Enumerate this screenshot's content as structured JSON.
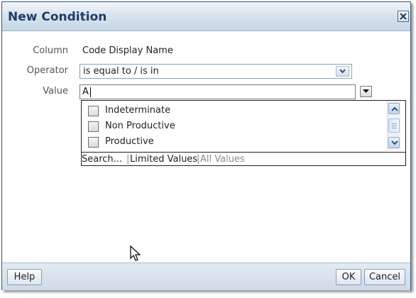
{
  "dialog": {
    "title": "New Condition"
  },
  "form": {
    "column_label": "Column",
    "column_value": "Code Display Name",
    "operator_label": "Operator",
    "operator_value": "is equal to / is in",
    "value_label": "Value",
    "value_input": "A"
  },
  "listbox": {
    "options": [
      {
        "label": "Indeterminate",
        "checked": false
      },
      {
        "label": "Non Productive",
        "checked": false
      },
      {
        "label": "Productive",
        "checked": false
      }
    ],
    "links": {
      "search": "Search...",
      "limited_values": "Limited Values",
      "separator": "|",
      "all_values": "All Values"
    }
  },
  "buttons": {
    "help": "Help",
    "ok": "OK",
    "cancel": "Cancel"
  },
  "icons": {
    "close": "close-icon",
    "dropdown": "chevron-down-icon",
    "scroll_up": "chevron-up-icon",
    "scroll_down": "chevron-down-icon",
    "cursor": "mouse-pointer-icon"
  }
}
